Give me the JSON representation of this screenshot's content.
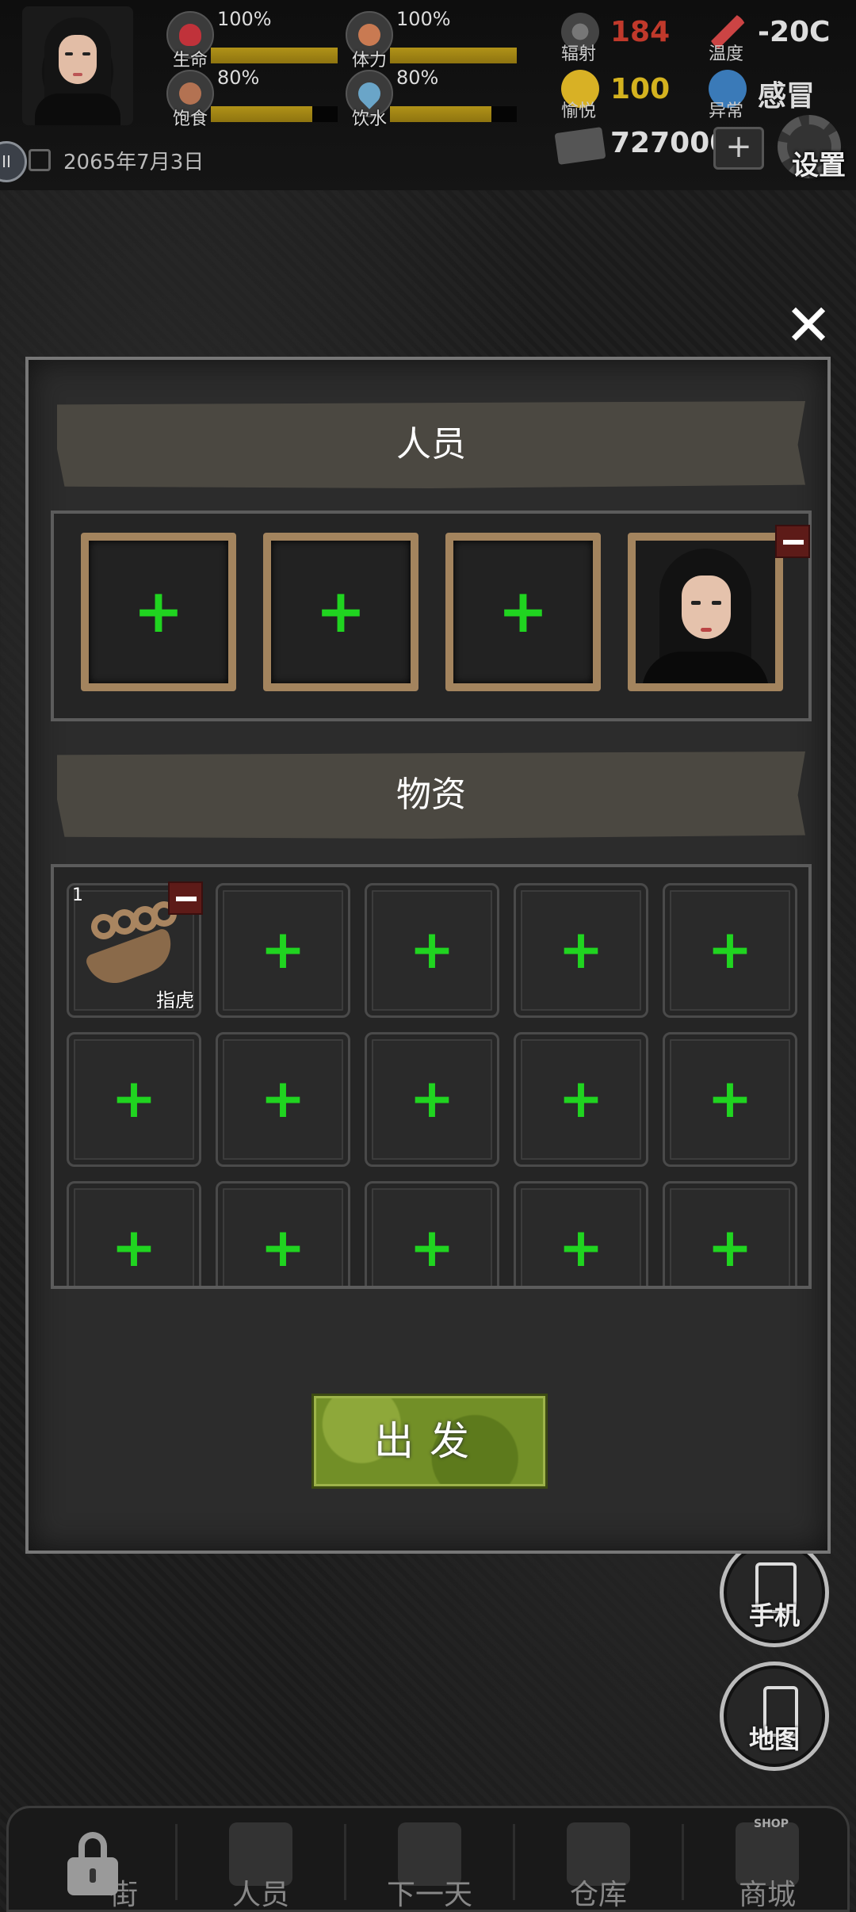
{
  "hud": {
    "stats": {
      "life": {
        "label": "生命",
        "percent": "100%",
        "level": 1.0
      },
      "stamina": {
        "label": "体力",
        "percent": "100%",
        "level": 1.0
      },
      "food": {
        "label": "饱食",
        "percent": "80%",
        "level": 0.8
      },
      "water": {
        "label": "饮水",
        "percent": "80%",
        "level": 0.8
      }
    },
    "radiation": {
      "label": "辐射",
      "value": "184",
      "color": "#c0392b"
    },
    "happiness": {
      "label": "愉悦",
      "value": "100",
      "color": "#d4b21f"
    },
    "temperature": {
      "label": "温度",
      "value": "-20C"
    },
    "condition": {
      "label": "异常",
      "value": "感冒"
    },
    "date": "2065年7月3日",
    "money": "727000",
    "plus": "+",
    "settings_label": "设置",
    "pause": "II"
  },
  "modal": {
    "close": "✕",
    "members_title": "人员",
    "supplies_title": "物资",
    "plus": "+",
    "item": {
      "count": "1",
      "name": "指虎"
    },
    "go_label": "出发"
  },
  "side_buttons": {
    "phone": "手机",
    "map": "地图"
  },
  "bottom_nav": {
    "items": [
      "街",
      "人员",
      "下一天",
      "仓库",
      "商城"
    ],
    "shop_tag": "SHOP"
  },
  "colors": {
    "plus_green": "#20d420",
    "stat_bar": "#b09218",
    "go_button": "#728f27",
    "frame_wood": "#a3845e",
    "remove_red": "#5d1b18"
  }
}
